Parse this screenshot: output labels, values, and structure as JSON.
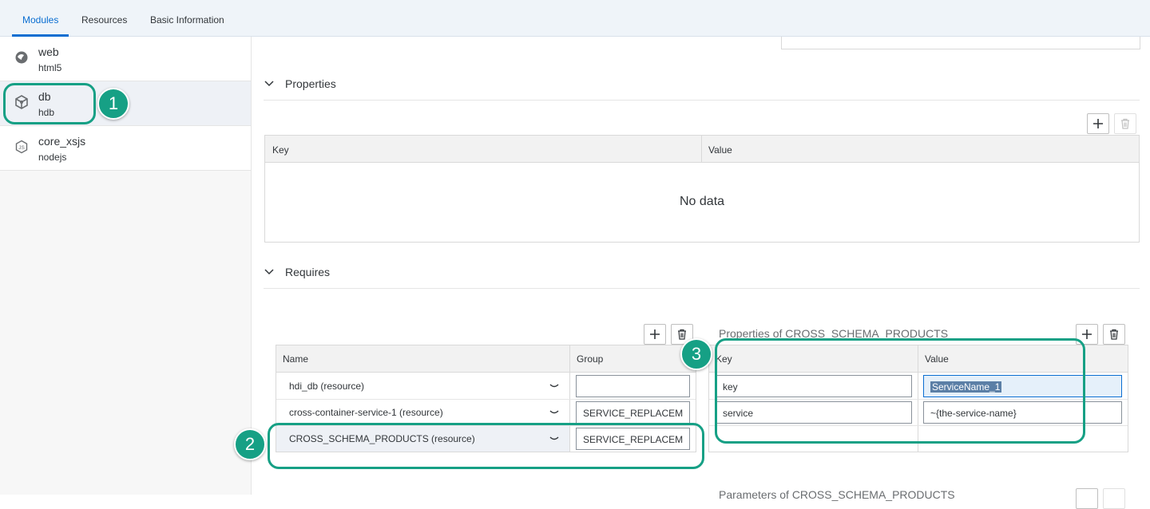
{
  "tabs": [
    {
      "label": "Modules"
    },
    {
      "label": "Resources"
    },
    {
      "label": "Basic Information"
    }
  ],
  "modules": [
    {
      "name": "web",
      "type": "html5",
      "icon": "html5-icon"
    },
    {
      "name": "db",
      "type": "hdb",
      "icon": "hdb-cube-icon"
    },
    {
      "name": "core_xsjs",
      "type": "nodejs",
      "icon": "nodejs-icon"
    }
  ],
  "properties": {
    "title": "Properties",
    "columns": [
      "Key",
      "Value"
    ],
    "empty_text": "No data"
  },
  "requires": {
    "title": "Requires",
    "columns": [
      "Name",
      "Group"
    ],
    "rows": [
      {
        "name": "hdi_db (resource)",
        "group": ""
      },
      {
        "name": "cross-container-service-1 (resource)",
        "group": "SERVICE_REPLACEM"
      },
      {
        "name": "CROSS_SCHEMA_PRODUCTS (resource)",
        "group": "SERVICE_REPLACEM"
      }
    ]
  },
  "req_properties": {
    "title": "Properties of CROSS_SCHEMA_PRODUCTS",
    "columns": [
      "Key",
      "Value"
    ],
    "rows": [
      {
        "key": "key",
        "value": "ServiceName_1"
      },
      {
        "key": "service",
        "value": "~{the-service-name}"
      }
    ],
    "next_title": "Parameters of CROSS_SCHEMA_PRODUCTS"
  },
  "callouts": [
    "1",
    "2",
    "3"
  ],
  "colors": {
    "accent": "#0a6ed1",
    "callout": "#16a085"
  }
}
